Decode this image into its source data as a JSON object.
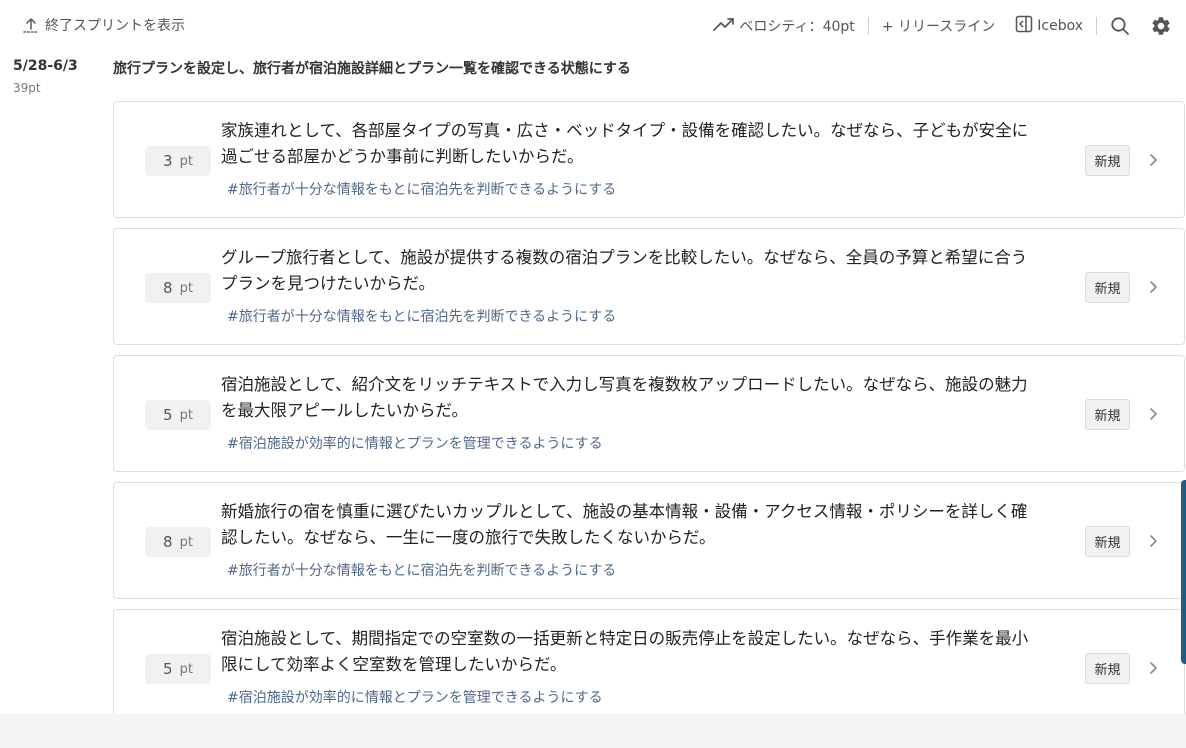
{
  "topbar": {
    "show_finished": "終了スプリントを表示",
    "velocity": "ベロシティ：40pt",
    "release_line": "+ リリースライン",
    "icebox": "Icebox",
    "icons": [
      "upload-icon",
      "trend-up-icon",
      "icebox-panel-icon",
      "search-icon",
      "gear-icon"
    ]
  },
  "sprint": {
    "date_range": "5/28-6/3",
    "points": "39pt",
    "goal": "旅行プランを設定し、旅行者が宿泊施設詳細とプラン一覧を確認できる状態にする"
  },
  "stories": [
    {
      "points": "3",
      "unit": "pt",
      "title": "家族連れとして、各部屋タイプの写真・広さ・ベッドタイプ・設備を確認したい。なぜなら、子どもが安全に過ごせる部屋かどうか事前に判断したいからだ。",
      "tag": "#旅行者が十分な情報をもとに宿泊先を判断できるようにする",
      "status": "新規"
    },
    {
      "points": "8",
      "unit": "pt",
      "title": "グループ旅行者として、施設が提供する複数の宿泊プランを比較したい。なぜなら、全員の予算と希望に合うプランを見つけたいからだ。",
      "tag": "#旅行者が十分な情報をもとに宿泊先を判断できるようにする",
      "status": "新規"
    },
    {
      "points": "5",
      "unit": "pt",
      "title": "宿泊施設として、紹介文をリッチテキストで入力し写真を複数枚アップロードしたい。なぜなら、施設の魅力を最大限アピールしたいからだ。",
      "tag": "#宿泊施設が効率的に情報とプランを管理できるようにする",
      "status": "新規"
    },
    {
      "points": "8",
      "unit": "pt",
      "title": "新婚旅行の宿を慎重に選びたいカップルとして、施設の基本情報・設備・アクセス情報・ポリシーを詳しく確認したい。なぜなら、一生に一度の旅行で失敗したくないからだ。",
      "tag": "#旅行者が十分な情報をもとに宿泊先を判断できるようにする",
      "status": "新規"
    },
    {
      "points": "5",
      "unit": "pt",
      "title": "宿泊施設として、期間指定での空室数の一括更新と特定日の販売停止を設定したい。なぜなら、手作業を最小限にして効率よく空室数を管理したいからだ。",
      "tag": "#宿泊施設が効率的に情報とプランを管理できるようにする",
      "status": "新規"
    }
  ],
  "colors": {
    "tag": "#50698a",
    "accent": "#1f5d86",
    "badge_bg": "#f1f1f1"
  }
}
